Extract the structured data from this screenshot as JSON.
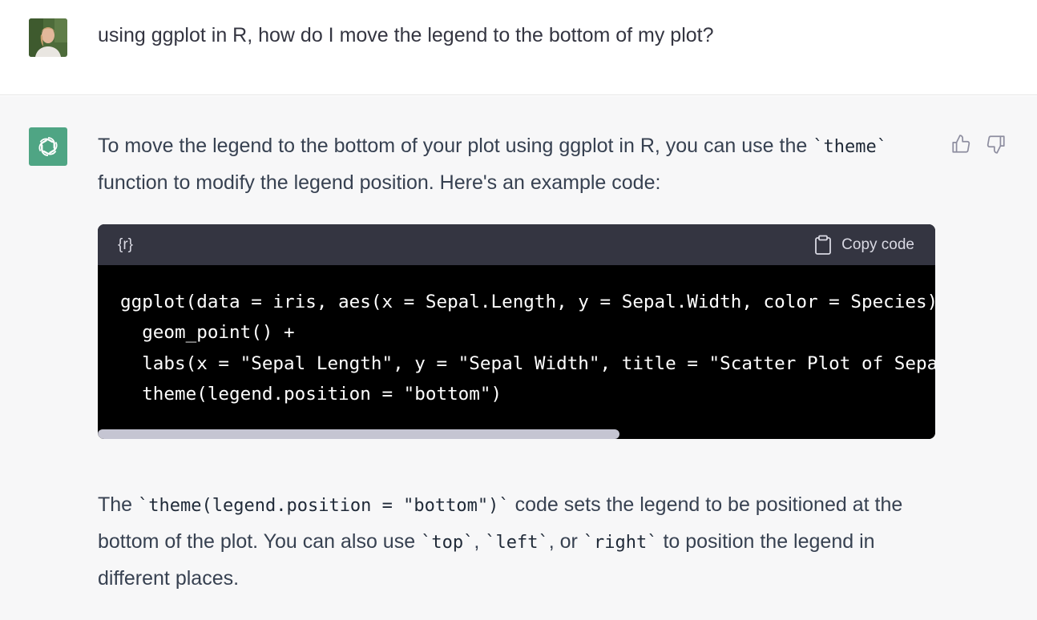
{
  "user_message": {
    "text": "using ggplot in R, how do I move the legend to the bottom of my plot?"
  },
  "assistant_message": {
    "intro": {
      "part1": "To move the legend to the bottom of your plot using ggplot in R, you can use the ",
      "code1": "`theme`",
      "part2": " function to modify the legend position. Here's an example code:"
    },
    "code_block": {
      "language": "{r}",
      "copy_label": "Copy code",
      "lines": [
        "ggplot(data = iris, aes(x = Sepal.Length, y = Sepal.Width, color = Species)) +",
        "  geom_point() +",
        "  labs(x = \"Sepal Length\", y = \"Sepal Width\", title = \"Scatter Plot of Sepal Length vs Width\") +",
        "  theme(legend.position = \"bottom\")"
      ]
    },
    "outro": {
      "part1": "The ",
      "code1": "`theme(legend.position = \"bottom\")`",
      "part2": " code sets the legend to be positioned at the bottom of the plot. You can also use ",
      "code2": "`top`",
      "part3": ", ",
      "code3": "`left`",
      "part4": ", or ",
      "code4": "`right`",
      "part5": " to position the legend in different places."
    },
    "feedback": {
      "up_icon": "thumbs-up-icon",
      "down_icon": "thumbs-down-icon"
    }
  },
  "colors": {
    "assistant_bg": "#f7f7f8",
    "gpt_avatar_bg": "#4fa584",
    "code_header_bg": "#343541",
    "code_bg": "#000000",
    "text": "#374151"
  }
}
